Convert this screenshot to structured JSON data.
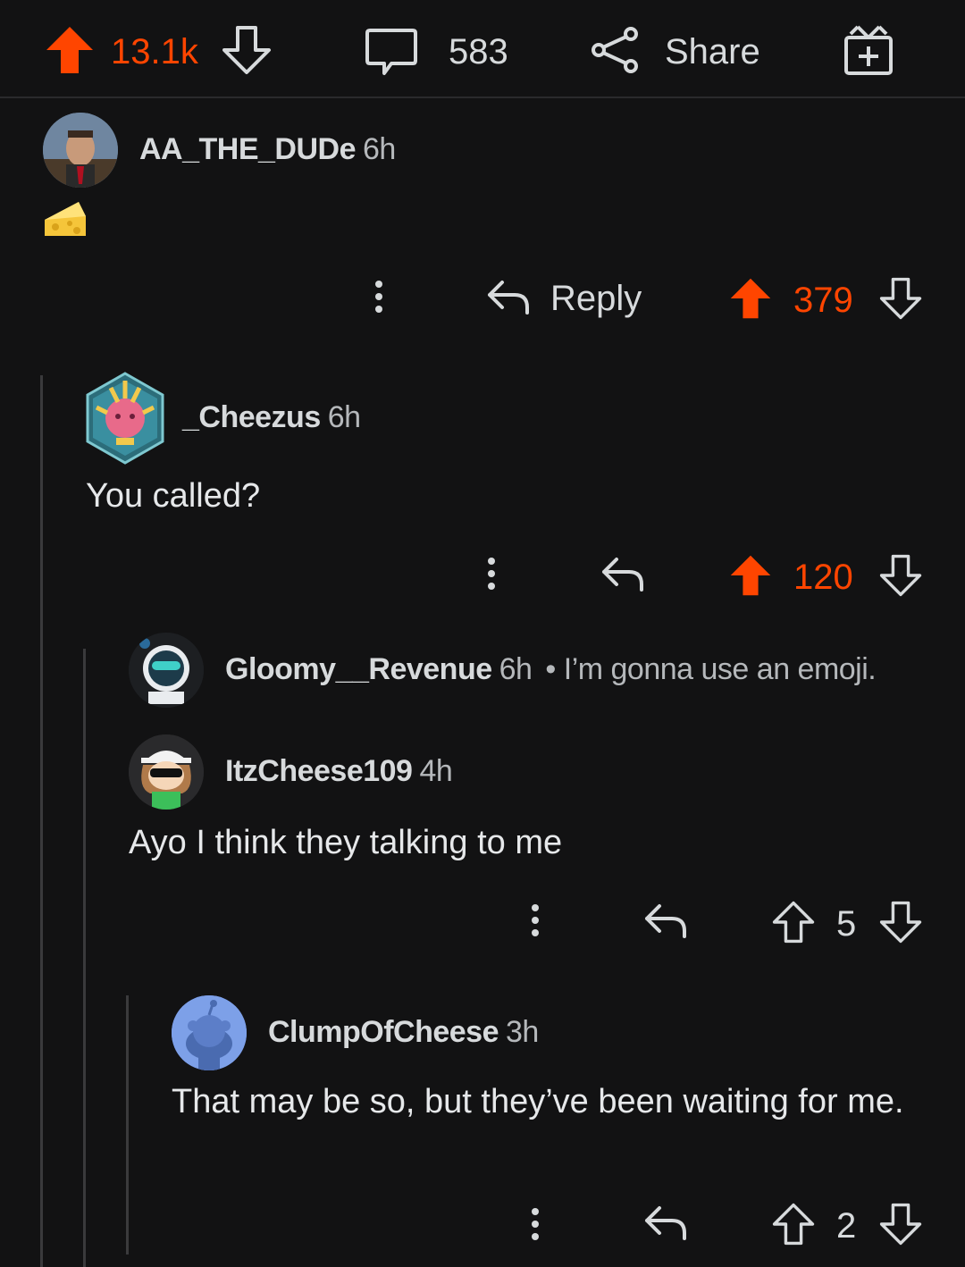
{
  "post_bar": {
    "upvotes": "13.1k",
    "comments": "583",
    "share_label": "Share",
    "colors": {
      "upvote_active": "#ff4500",
      "text": "#d7dadc"
    }
  },
  "comments": [
    {
      "username": "AA_THE_DUDe",
      "age": "6h",
      "body": "🧀",
      "reply_label": "Reply",
      "score": "379",
      "upvoted": true
    },
    {
      "username": "_Cheezus",
      "age": "6h",
      "body": "You called?",
      "score": "120",
      "upvoted": true
    },
    {
      "username": "Gloomy__Revenue",
      "age": "6h",
      "collapsed_preview": "• I’m gonna use an emoji."
    },
    {
      "username": "ItzCheese109",
      "age": "4h",
      "body": "Ayo I think they talking to me",
      "score": "5",
      "upvoted": false
    },
    {
      "username": "ClumpOfCheese",
      "age": "3h",
      "body": "That may be so, but they’ve been waiting for me.",
      "score": "2",
      "upvoted": false
    }
  ]
}
